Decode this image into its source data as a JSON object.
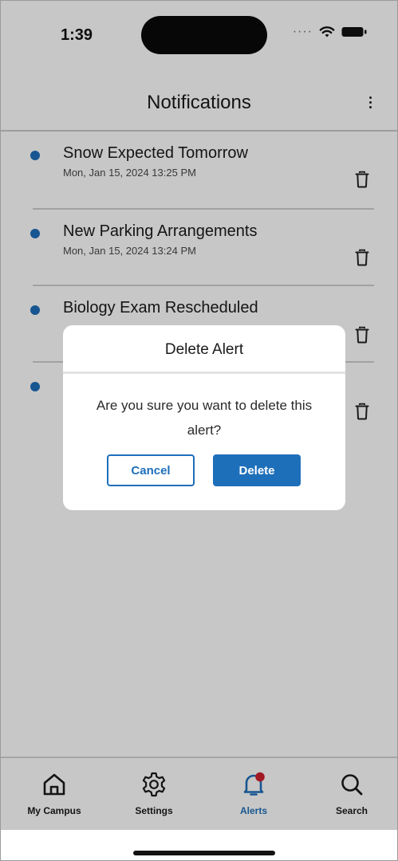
{
  "status_bar": {
    "time": "1:39"
  },
  "header": {
    "title": "Notifications"
  },
  "alerts": [
    {
      "title": "Snow Expected Tomorrow",
      "date": "Mon, Jan 15, 2024 13:25 PM"
    },
    {
      "title": "New Parking Arrangements",
      "date": "Mon, Jan 15, 2024 13:24 PM"
    },
    {
      "title": "Biology Exam Rescheduled",
      "date": ""
    },
    {
      "title": "",
      "date": ""
    }
  ],
  "dialog": {
    "title": "Delete Alert",
    "message": "Are you sure you want to delete this alert?",
    "cancel_label": "Cancel",
    "delete_label": "Delete"
  },
  "tabbar": {
    "items": [
      {
        "label": "My Campus",
        "icon": "home-icon"
      },
      {
        "label": "Settings",
        "icon": "gear-icon"
      },
      {
        "label": "Alerts",
        "icon": "bell-icon",
        "active": true,
        "badge": true
      },
      {
        "label": "Search",
        "icon": "search-icon"
      }
    ]
  },
  "colors": {
    "accent": "#1e6fba",
    "badge": "#d0202e",
    "unread_dot": "#1e6fba"
  }
}
